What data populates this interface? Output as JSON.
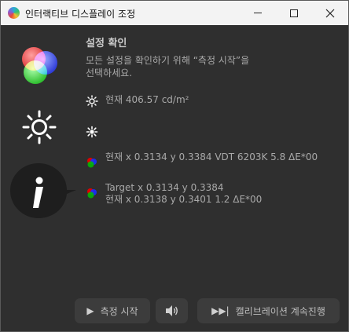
{
  "window": {
    "title": "인터랙티브 디스플레이 조정"
  },
  "main": {
    "heading": "설정 확인",
    "description_line1": "모든 설정을 확인하기 위해 “측정 시작”을",
    "description_line2": "선택하세요.",
    "brightness_text": "현재 406.57 cd/m²",
    "white_point_text": "현재 x 0.3134 y 0.3384 VDT 6203K 5.8 ΔE*00",
    "target_text": "Target x 0.3134 y 0.3384",
    "current_text": "현재 x 0.3138 y 0.3401 1.2 ΔE*00"
  },
  "buttons": {
    "start_label": "측정 시작",
    "continue_label": "캘리브레이션 계속진행"
  },
  "colors": {
    "accent": "#ffffff",
    "panel": "#2f2f2f",
    "button": "#3c3c3c"
  }
}
